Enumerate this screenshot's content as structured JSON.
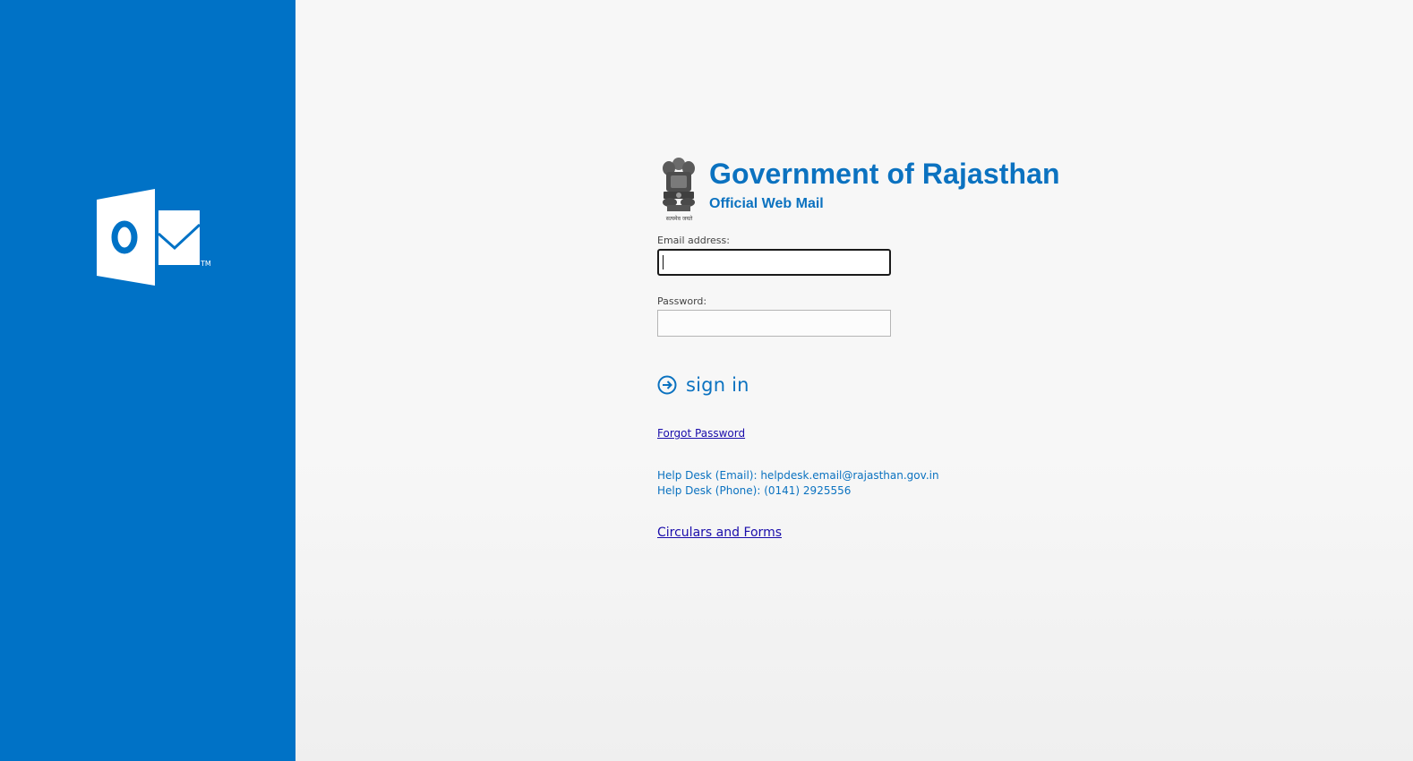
{
  "colors": {
    "brand_blue": "#0072c6",
    "title_blue": "#0b72c0",
    "link_color": "#1a0dab",
    "page_background": "#f7f7f7"
  },
  "sidebar": {
    "logo_icon": "outlook-logo-icon",
    "logo_trademark": "TM"
  },
  "header": {
    "emblem_icon": "state-emblem-icon",
    "emblem_motto": "सत्यमेव जयते",
    "title": "Government of Rajasthan",
    "subtitle": "Official Web Mail"
  },
  "form": {
    "email_label": "Email address:",
    "email_value": "",
    "password_label": "Password:",
    "password_value": "",
    "sign_in_icon": "arrow-circle-right-icon",
    "sign_in_label": "sign in"
  },
  "links": {
    "forgot_password": "Forgot Password",
    "circulars": "Circulars and Forms"
  },
  "help": {
    "email_line": "Help Desk (Email): helpdesk.email@rajasthan.gov.in",
    "phone_line": "Help Desk (Phone): (0141) 2925556"
  }
}
